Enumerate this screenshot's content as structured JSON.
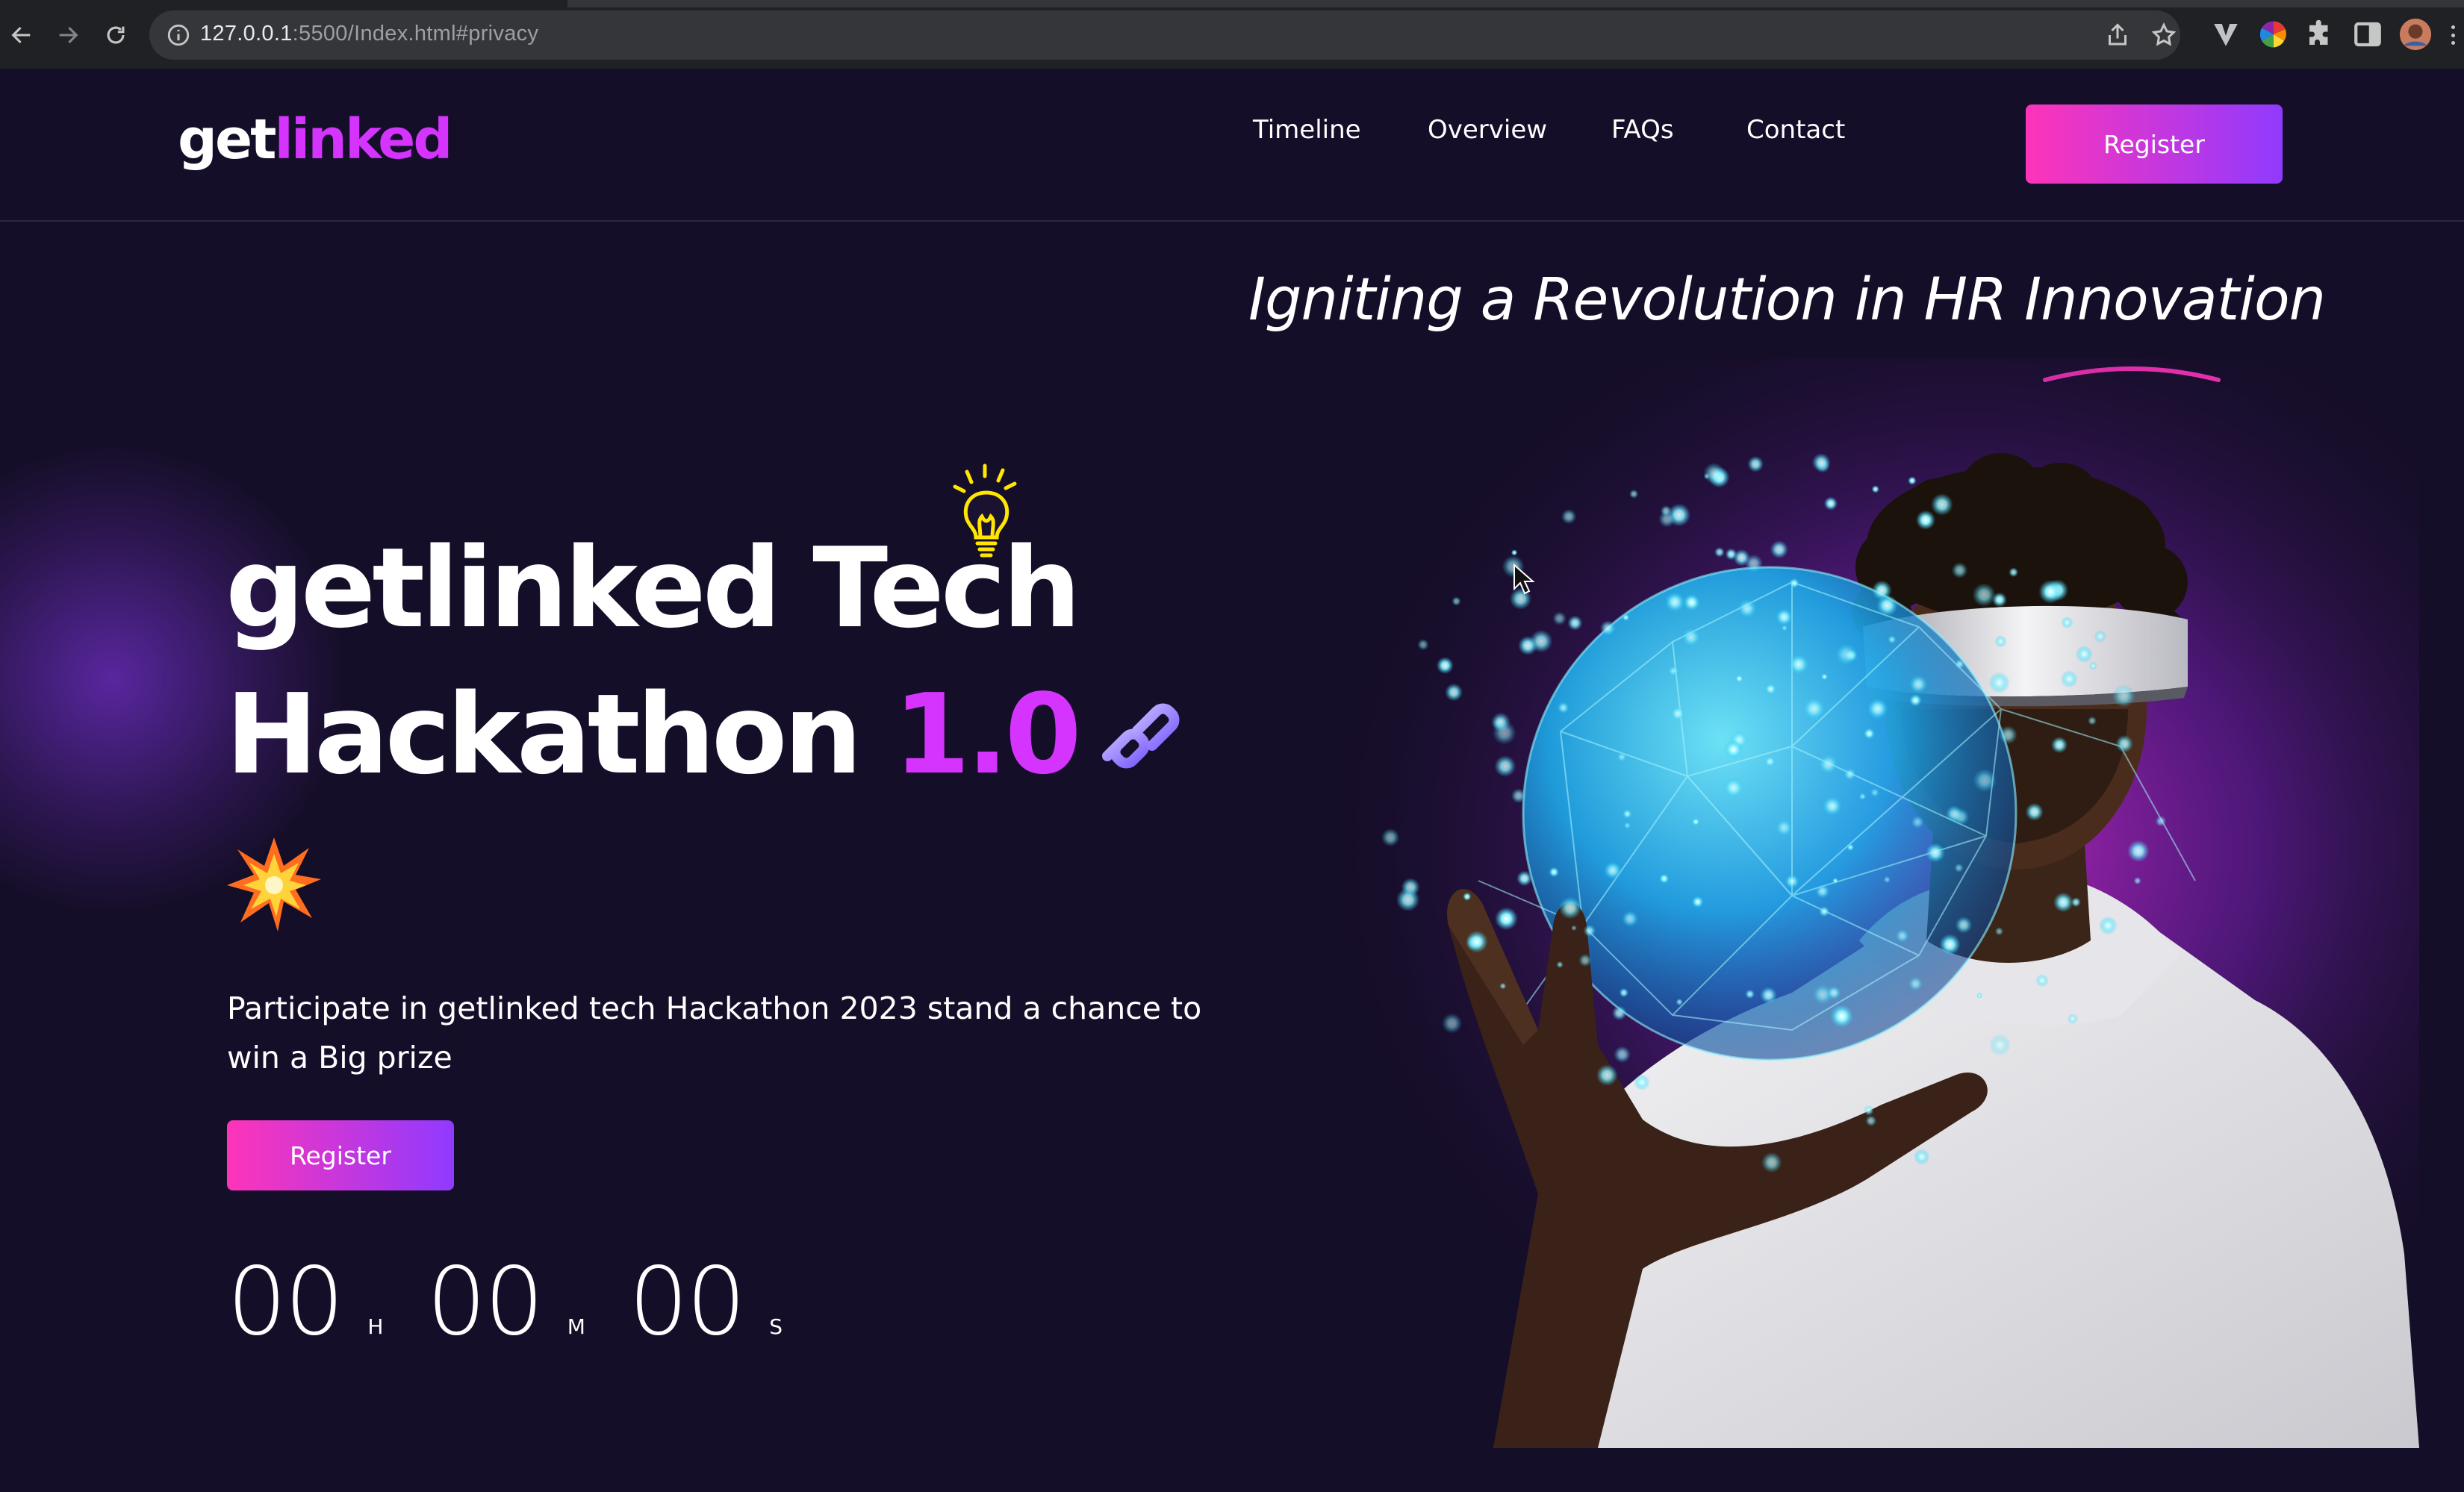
{
  "browser": {
    "url_host": "127.0.0.1",
    "url_rest": ":5500/Index.html#privacy",
    "icons": [
      "back-icon",
      "forward-icon",
      "reload-icon",
      "info-icon",
      "share-icon",
      "star-icon",
      "extension-v-icon",
      "color-wheel-icon",
      "puzzle-icon",
      "side-panel-icon",
      "profile-avatar"
    ]
  },
  "nav": {
    "logo_part1": "get",
    "logo_part2": "linked",
    "links": [
      "Timeline",
      "Overview",
      "FAQs",
      "Contact"
    ],
    "register_label": "Register"
  },
  "hero": {
    "tagline": "Igniting a Revolution in HR Innovation",
    "title_line1": "getlinked Tech",
    "title_line2_word": "Hackathon",
    "title_line2_accent": "1.0",
    "description": "Participate in getlinked tech Hackathon 2023 stand a chance to win a Big prize",
    "register_label": "Register",
    "countdown": {
      "hours": "00",
      "hours_unit": "H",
      "minutes": "00",
      "minutes_unit": "M",
      "seconds": "00",
      "seconds_unit": "S"
    },
    "decor_icons": [
      "lightbulb-icon",
      "chain-link-icon",
      "explosion-icon"
    ]
  },
  "colors": {
    "background": "#150e28",
    "accent_purple": "#d434fe",
    "gradient_start": "#fe34b9",
    "gradient_end": "#903aff"
  }
}
